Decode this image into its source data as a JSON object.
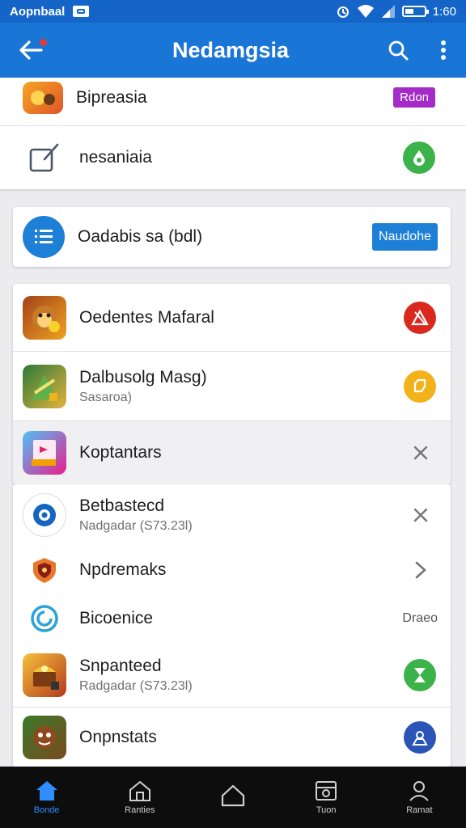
{
  "status_bar": {
    "carrier": "Aopnbaal",
    "time": "1:60",
    "icons": [
      "notification-icon",
      "alarm-icon",
      "wifi-icon",
      "signal-icon",
      "battery-icon"
    ]
  },
  "app_bar": {
    "title": "Nedamgsia",
    "icons": [
      "back-arrow-icon",
      "search-icon",
      "more-vert-icon"
    ]
  },
  "top_list": [
    {
      "name": "Bipreasia",
      "badge": "Rdon",
      "badge_color": "#a52bc9",
      "icon": "game-app-icon"
    },
    {
      "name": "nesaniaia",
      "icon": "edit-icon",
      "action_color": "#3bb34a",
      "action_icon": "download-drop-icon"
    }
  ],
  "featured": {
    "name": "Oadabis sa (bdl)",
    "button_label": "Naudohe",
    "button_color": "#1e7fd6",
    "icon": "list-icon"
  },
  "main_list": [
    {
      "name": "Oedentes Mafaral",
      "icon": "monkey-game-icon",
      "action_color": "#d9281e",
      "action_icon": "warning-triangle-icon"
    },
    {
      "name": "Dalbusolg Masg)",
      "sub": "Sasaroa)",
      "icon": "adventure-game-icon",
      "action_color": "#f2b21a",
      "action_icon": "tag-icon"
    },
    {
      "name": "Koptantars",
      "icon": "book-app-icon",
      "action_icon": "close-icon"
    }
  ],
  "lower_list": [
    {
      "name": "Betbastecd",
      "sub": "Nadgadar (S73.23l)",
      "icon": "swirl-app-icon",
      "action_icon": "close-icon"
    },
    {
      "name": "Npdremaks",
      "icon": "shield-app-icon",
      "action_icon": "chevron-right-icon"
    },
    {
      "name": "Bicoenice",
      "icon": "spiral-app-icon",
      "trail_text": "Draeo"
    },
    {
      "name": "Snpanteed",
      "sub": "Radgadar (S73.23l)",
      "icon": "treasure-game-icon",
      "action_color": "#3bb34a",
      "action_icon": "hourglass-icon"
    },
    {
      "name": "Onpnstats",
      "icon": "character-game-icon",
      "action_color": "#2a54b5",
      "action_icon": "location-icon"
    }
  ],
  "bottom_nav": [
    {
      "label": "Bonde",
      "icon": "home-icon",
      "active": true
    },
    {
      "label": "Ranties",
      "icon": "home-outline-icon",
      "active": false
    },
    {
      "label": "",
      "icon": "house-icon",
      "active": false
    },
    {
      "label": "Tuon",
      "icon": "media-icon",
      "active": false
    },
    {
      "label": "Ramat",
      "icon": "profile-icon",
      "active": false
    }
  ],
  "colors": {
    "primary": "#1976d6",
    "status_bar": "#1565c8",
    "background": "#ececef",
    "nav_active": "#2f8dff"
  }
}
